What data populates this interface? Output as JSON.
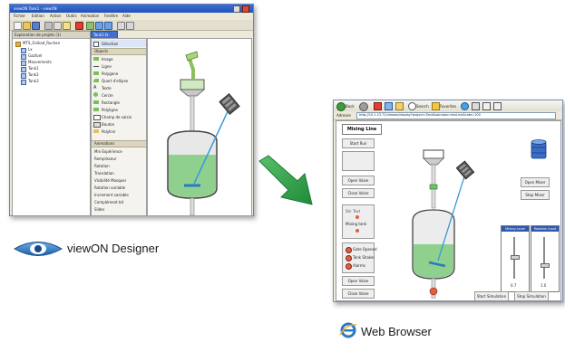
{
  "designer": {
    "title": "viewON  Tank1 - viewON",
    "menu": [
      "Fichier",
      "Edition",
      "Action",
      "Outils",
      "Animation",
      "Fenêtre",
      "Aide"
    ],
    "explorer_title": "Exploration de projets (1)",
    "tree": [
      "MTS_Ovikad_Ruchan",
      "Lx",
      "Gazfuel",
      "Mouvements",
      "Tank1",
      "Tank2",
      "Tank3"
    ],
    "canvas_tab": "Tank1.fx",
    "palette_groups": {
      "top": "Sélection",
      "objects": "Objects",
      "animations": "Animations"
    },
    "palette_items": [
      "Image",
      "Ligne",
      "Polygone",
      "Quart d'ellipse",
      "Texte",
      "Cercle",
      "Rectangle",
      "Polyligne",
      "Champ de saisie",
      "Bouton",
      "Polyline"
    ],
    "animation_items": [
      "Min Expérience",
      "Remplisseur",
      "Rotation",
      "Translation",
      "Visibilité Masquer",
      "Rotation variable",
      "Increment variable",
      "Complément bit",
      "Slider"
    ]
  },
  "browser": {
    "address_label": "Adresse",
    "address_value": "http://10.1.23.71/viewon/display?project=Tank&window=mixLine&rate=100",
    "toolbar_labels": [
      "Back",
      "Search",
      "Favorites"
    ],
    "page_title": "Mixing Line",
    "buttons_left": [
      "Start Run",
      "Open Valve",
      "Close Valve",
      "Open Valve",
      "Close Valve"
    ],
    "status_panel_lines": [
      "Stir Text",
      "Mixing tank"
    ],
    "indicator_labels": [
      "Gate Opened",
      "Tank Shaker",
      "Alarms"
    ],
    "buttons_right": [
      "Open Mixer",
      "Stop Mixer"
    ],
    "slider_titles": [
      "Mixing Level",
      "Rotation Input"
    ],
    "slider_values": [
      "0.7",
      "1.0"
    ],
    "bottom_buttons": [
      "Start Simulation",
      "Stop Simulation"
    ],
    "levels": {
      "mix_tank": 0.45,
      "slider1": 0.55,
      "slider2": 0.35
    }
  },
  "captions": {
    "designer": "viewON Designer",
    "browser": "Web Browser"
  },
  "colors": {
    "accent": "#2f58b0",
    "liquid": "#8fd08f",
    "arrow": "#2f9e4a",
    "alarm": "#e06040"
  }
}
